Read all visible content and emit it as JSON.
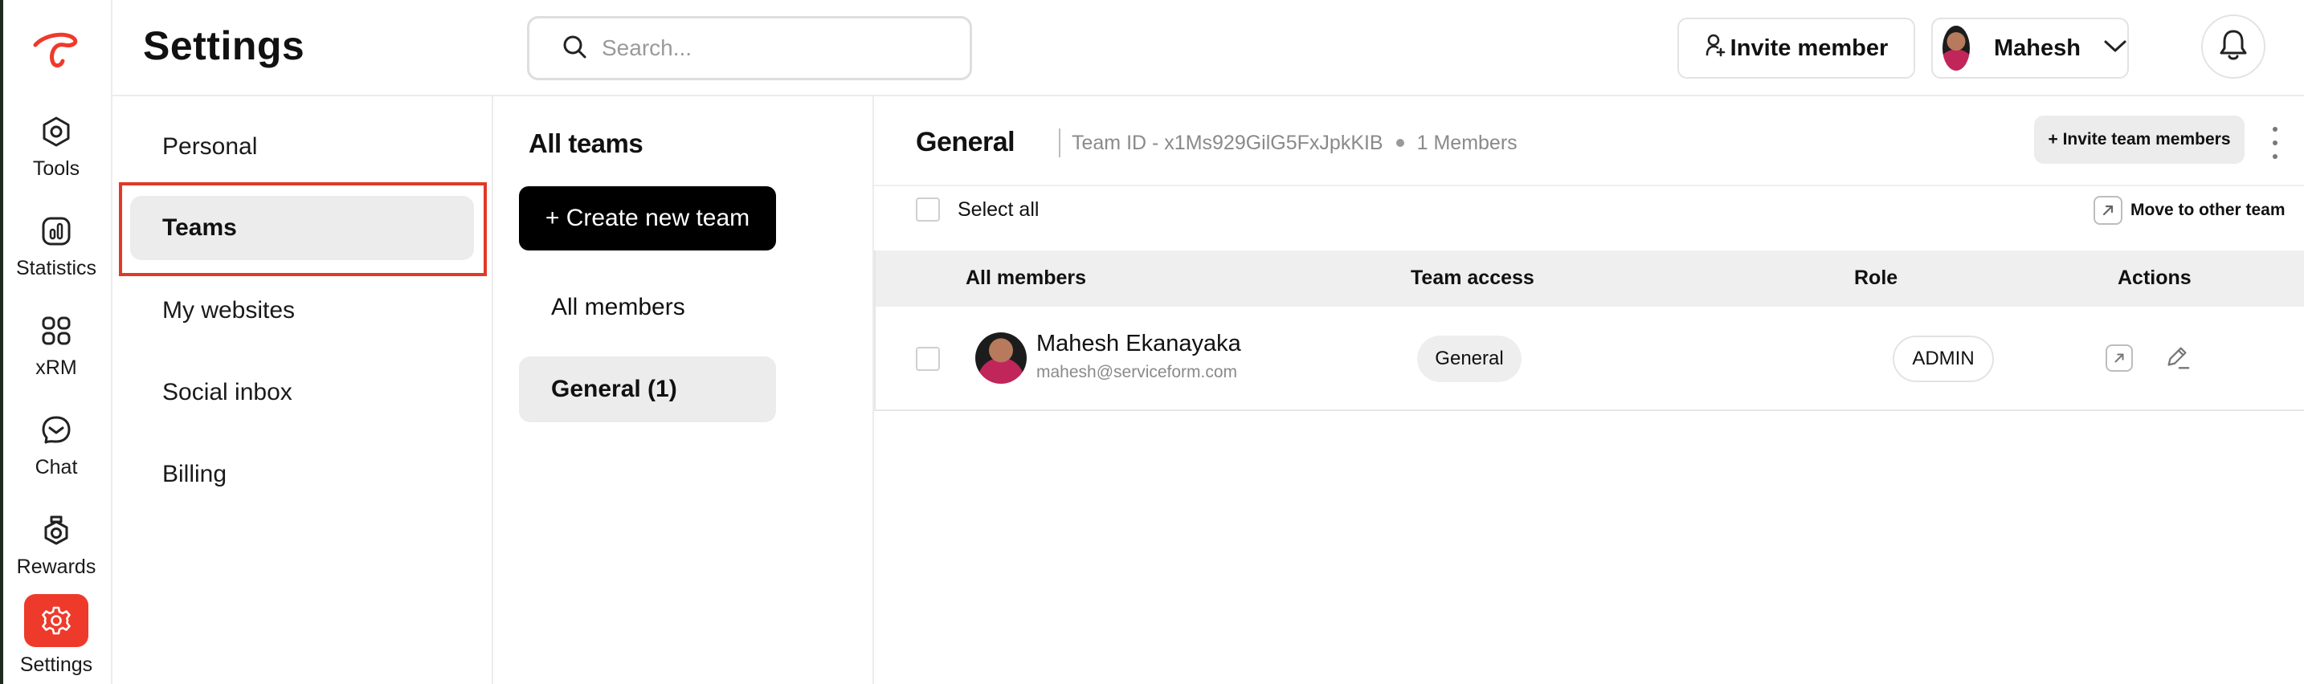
{
  "app": {
    "page_title": "Settings",
    "brand_color": "#ee3a2b",
    "logo_icon": "app-logo-icon"
  },
  "rail": {
    "items": [
      {
        "label": "Tools",
        "icon": "hexagon-icon"
      },
      {
        "label": "Statistics",
        "icon": "bar-chart-icon"
      },
      {
        "label": "xRM",
        "icon": "grid-icon"
      },
      {
        "label": "Chat",
        "icon": "chat-icon"
      },
      {
        "label": "Rewards",
        "icon": "award-icon"
      },
      {
        "label": "Settings",
        "icon": "gear-icon",
        "active": true
      }
    ]
  },
  "header": {
    "search_placeholder": "Search...",
    "invite_label": "Invite member",
    "user_name": "Mahesh"
  },
  "settings_menu": {
    "items": [
      "Personal",
      "Teams",
      "My websites",
      "Social inbox",
      "Billing"
    ],
    "active": "Teams"
  },
  "teams_panel": {
    "title": "All teams",
    "create_label": "+ Create new team",
    "items": [
      "All members",
      "General (1)"
    ],
    "active": "General (1)"
  },
  "team_detail": {
    "name": "General",
    "team_id": "Team ID - x1Ms929GilG5FxJpkKIB",
    "members_count": "1 Members",
    "invite_label": "+ Invite team members",
    "select_all_label": "Select all",
    "move_label": "Move to other team",
    "columns": [
      "All members",
      "Team access",
      "Role",
      "Actions"
    ],
    "rows": [
      {
        "name": "Mahesh Ekanayaka",
        "email": "mahesh@serviceform.com",
        "team_access": "General",
        "role": "ADMIN"
      }
    ]
  }
}
